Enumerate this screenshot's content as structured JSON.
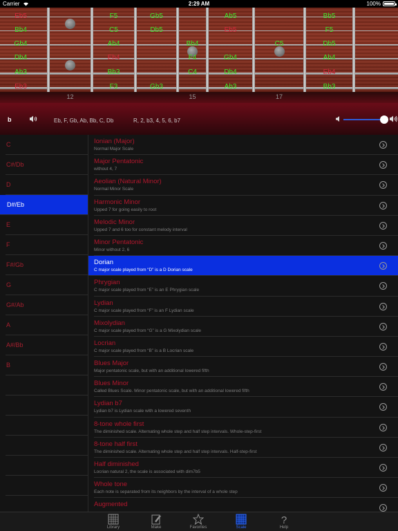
{
  "status_bar": {
    "carrier": "Carrier",
    "time": "2:29 AM",
    "battery_text": "100%",
    "battery_level": 1.0
  },
  "fretboard": {
    "strings": 6,
    "fret_numbers": [
      {
        "label": "12",
        "fret": 12
      },
      {
        "label": "15",
        "fret": 15
      },
      {
        "label": "17",
        "fret": 17
      }
    ],
    "position_markers": [
      {
        "string_gap": 1,
        "fret": 12
      },
      {
        "string_gap": 4,
        "fret": 12
      },
      {
        "string_gap": 3,
        "fret": 15
      },
      {
        "string_gap": 3,
        "fret": 17
      }
    ],
    "notes": [
      {
        "label": "Eb5",
        "color": "#d8283c",
        "string": 1,
        "fret": 11
      },
      {
        "label": "F5",
        "color": "#3dea2a",
        "string": 1,
        "fret": 13
      },
      {
        "label": "Gb5",
        "color": "#3dea2a",
        "string": 1,
        "fret": 14
      },
      {
        "label": "Ab5",
        "color": "#3dea2a",
        "string": 1,
        "fret": 16
      },
      {
        "label": "Bb5",
        "color": "#3dea2a",
        "string": 1,
        "fret": 18
      },
      {
        "label": "Bb4",
        "color": "#3dea2a",
        "string": 2,
        "fret": 11
      },
      {
        "label": "C5",
        "color": "#3dea2a",
        "string": 2,
        "fret": 13
      },
      {
        "label": "Db5",
        "color": "#3dea2a",
        "string": 2,
        "fret": 14
      },
      {
        "label": "Eb5",
        "color": "#d8283c",
        "string": 2,
        "fret": 16
      },
      {
        "label": "F5",
        "color": "#3dea2a",
        "string": 2,
        "fret": 18
      },
      {
        "label": "Gb4",
        "color": "#3dea2a",
        "string": 3,
        "fret": 11
      },
      {
        "label": "Ab4",
        "color": "#3dea2a",
        "string": 3,
        "fret": 13
      },
      {
        "label": "Bb4",
        "color": "#3dea2a",
        "string": 3,
        "fret": 15
      },
      {
        "label": "C5",
        "color": "#3dea2a",
        "string": 3,
        "fret": 17
      },
      {
        "label": "Db5",
        "color": "#3dea2a",
        "string": 3,
        "fret": 18
      },
      {
        "label": "Db4",
        "color": "#3dea2a",
        "string": 4,
        "fret": 11
      },
      {
        "label": "Eb4",
        "color": "#d8283c",
        "string": 4,
        "fret": 13
      },
      {
        "label": "F4",
        "color": "#3dea2a",
        "string": 4,
        "fret": 15
      },
      {
        "label": "Gb4",
        "color": "#3dea2a",
        "string": 4,
        "fret": 16
      },
      {
        "label": "Ab4",
        "color": "#3dea2a",
        "string": 4,
        "fret": 18
      },
      {
        "label": "Ab3",
        "color": "#3dea2a",
        "string": 5,
        "fret": 11
      },
      {
        "label": "Bb3",
        "color": "#3dea2a",
        "string": 5,
        "fret": 13
      },
      {
        "label": "C4",
        "color": "#3dea2a",
        "string": 5,
        "fret": 15
      },
      {
        "label": "Db4",
        "color": "#3dea2a",
        "string": 5,
        "fret": 16
      },
      {
        "label": "Eb4",
        "color": "#d8283c",
        "string": 5,
        "fret": 18
      },
      {
        "label": "Eb3",
        "color": "#d8283c",
        "string": 6,
        "fret": 11
      },
      {
        "label": "F3",
        "color": "#3dea2a",
        "string": 6,
        "fret": 13
      },
      {
        "label": "Gb3",
        "color": "#3dea2a",
        "string": 6,
        "fret": 14
      },
      {
        "label": "Ab3",
        "color": "#3dea2a",
        "string": 6,
        "fret": 16
      },
      {
        "label": "Bb3",
        "color": "#3dea2a",
        "string": 6,
        "fret": 18
      }
    ]
  },
  "controls": {
    "accidental_label": "b",
    "speaker_icon": "speaker-icon",
    "scale_notes": "Eb, F, Gb, Ab, Bb, C, Db",
    "scale_intervals": "R, 2, b3, 4, 5, 6, b7",
    "volume_level": 1.0
  },
  "keys": {
    "selected_index": 3,
    "items": [
      "C",
      "C#/Db",
      "D",
      "D#/Eb",
      "E",
      "F",
      "F#/Gb",
      "G",
      "G#/Ab",
      "A",
      "A#/Bb",
      "B"
    ]
  },
  "scales": {
    "selected_index": 6,
    "items": [
      {
        "name": "Ionian (Major)",
        "desc": "Normal Major Scale"
      },
      {
        "name": "Major Pentatonic",
        "desc": "without 4, 7"
      },
      {
        "name": "Aeolian (Natural Minor)",
        "desc": "Normal Minor Scale"
      },
      {
        "name": "Harmonic Minor",
        "desc": "Upped 7 for going easily to root"
      },
      {
        "name": "Melodic Minor",
        "desc": "Upped 7 and 6 too for constant melody interval"
      },
      {
        "name": "Minor Pentatonic",
        "desc": "Minor without 2, 6"
      },
      {
        "name": "Dorian",
        "desc": "C major scale played from “D” is a D Dorian scale"
      },
      {
        "name": "Phrygian",
        "desc": "C major scale played from “E” is an E Phrygian scale"
      },
      {
        "name": "Lydian",
        "desc": "C major scale played from “F” is an F Lydian scale"
      },
      {
        "name": "Mixolydian",
        "desc": "C major scale played from “G” is a G Mixolydian scale"
      },
      {
        "name": "Locrian",
        "desc": "C major scale played from “B” is a B Locrian scale"
      },
      {
        "name": "Blues Major",
        "desc": "Major pentatonic scale, but with an additional lowered fifth"
      },
      {
        "name": "Blues Minor",
        "desc": "Called Blues Scale. Minor pentatonic scale, but with an additional lowered fifth"
      },
      {
        "name": "Lydian b7",
        "desc": "Lydian b7 is Lydian scale with a lowered seventh"
      },
      {
        "name": "8-tone whole first",
        "desc": "The diminished scale. Alternating whole step and half step intervals. Whole-step-first"
      },
      {
        "name": "8-tone half first",
        "desc": "The diminished scale. Alternating whole step and half step intervals. Half-step-first"
      },
      {
        "name": "Half diminished",
        "desc": "Locrian natural 2, the scale is associated with dim7b5"
      },
      {
        "name": "Whole tone",
        "desc": "Each note is separated from its neighbors by the interval of a whole step"
      },
      {
        "name": "Augmented",
        "desc": ""
      }
    ]
  },
  "tabs": {
    "active_index": 3,
    "items": [
      {
        "label": "Library",
        "icon": "library-icon"
      },
      {
        "label": "Make",
        "icon": "make-icon"
      },
      {
        "label": "Favorites",
        "icon": "star-icon"
      },
      {
        "label": "Scale",
        "icon": "scale-icon"
      },
      {
        "label": "Help",
        "icon": "help-icon"
      }
    ]
  }
}
